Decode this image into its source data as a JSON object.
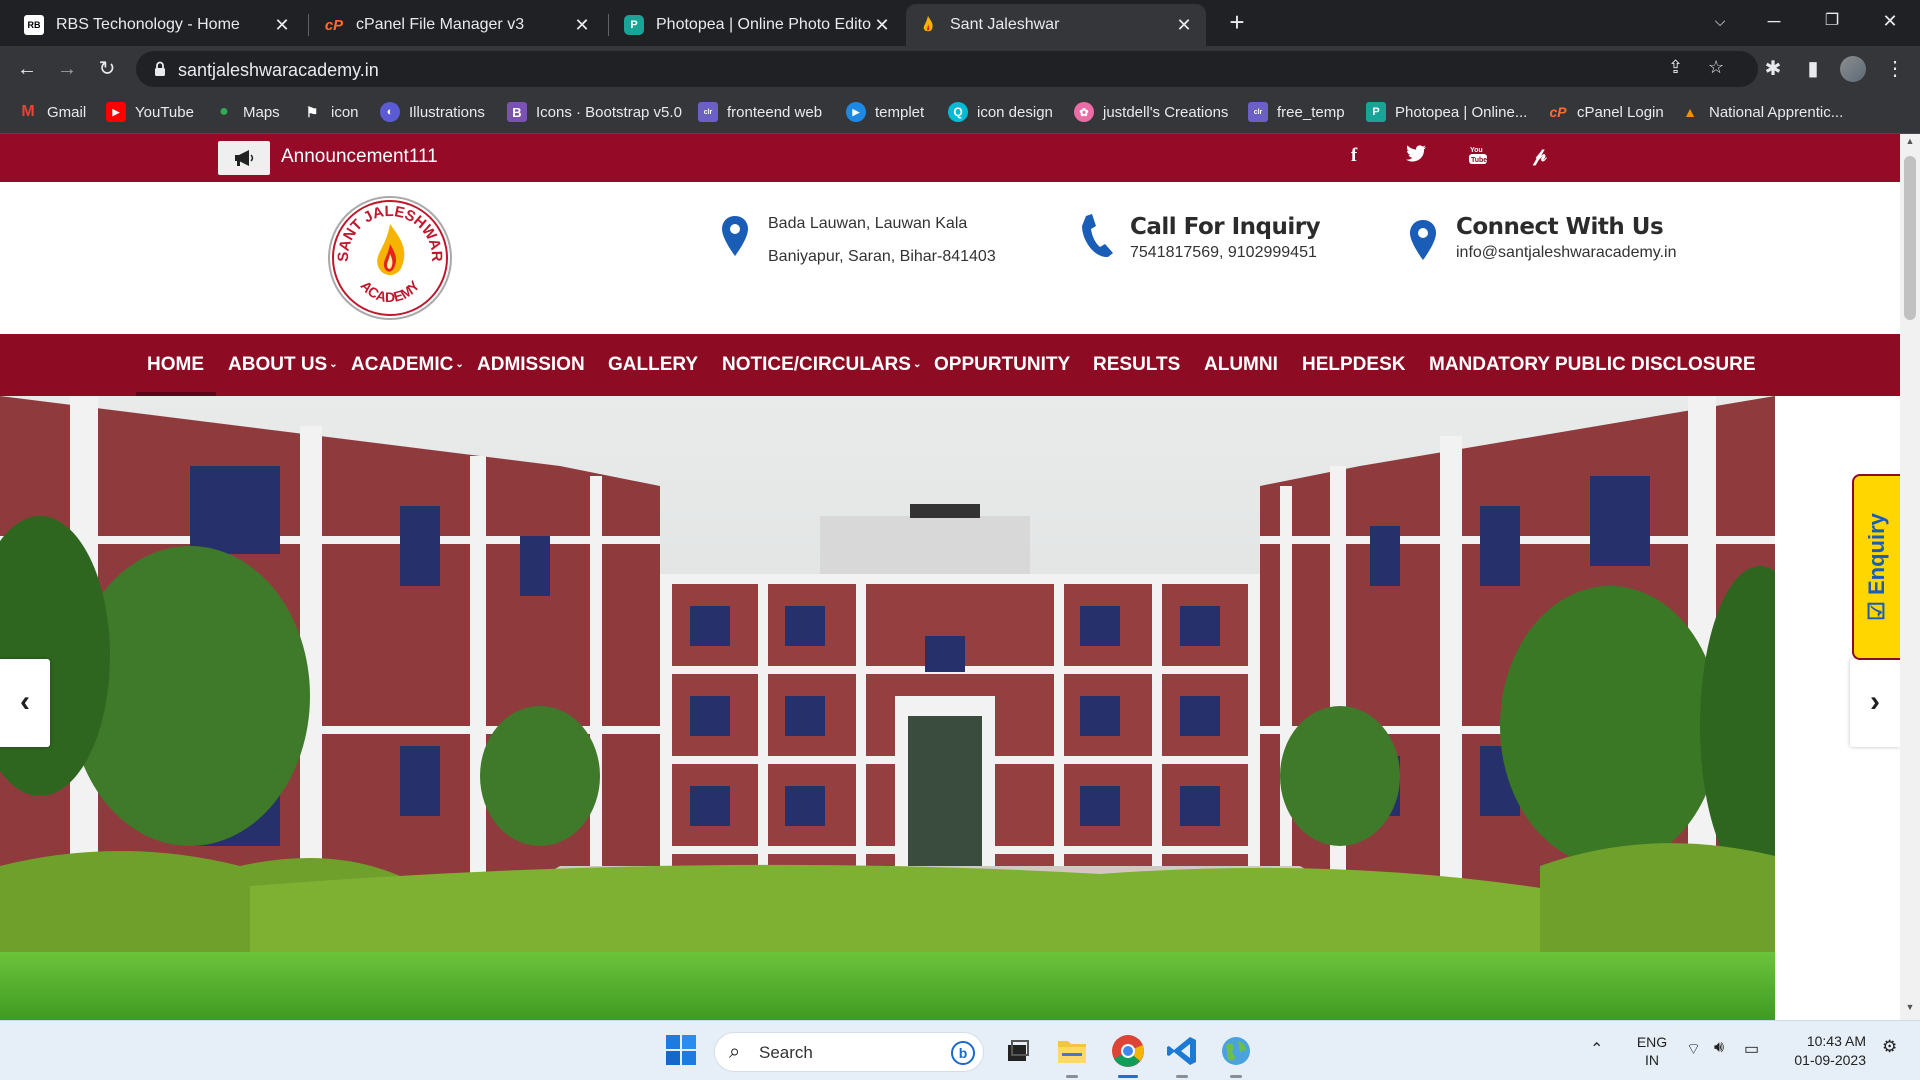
{
  "browser": {
    "tabs": [
      {
        "title": "RBS Techonology - Home",
        "favicon": "RB"
      },
      {
        "title": "cPanel File Manager v3",
        "favicon": "cP"
      },
      {
        "title": "Photopea | Online Photo Editor",
        "favicon": "P"
      },
      {
        "title": "Sant Jaleshwar",
        "favicon": "flame"
      }
    ],
    "url": "santjaleshwaracademy.in",
    "bookmarks": [
      {
        "label": "Gmail",
        "icon": "gmail-icon",
        "color": "#ea4335"
      },
      {
        "label": "YouTube",
        "icon": "youtube-icon",
        "color": "#ff0000"
      },
      {
        "label": "Maps",
        "icon": "maps-icon",
        "color": "#34a853"
      },
      {
        "label": "icon",
        "icon": "flag-icon",
        "color": "#ffffff"
      },
      {
        "label": "Illustrations",
        "icon": "illustrations-icon",
        "color": "#5b5bd6"
      },
      {
        "label": "Icons · Bootstrap v5.0",
        "icon": "bootstrap-icon",
        "color": "#7952b3"
      },
      {
        "label": "fronteend web",
        "icon": "colorlib-icon",
        "color": "#6c5fc7"
      },
      {
        "label": "templet",
        "icon": "play-icon",
        "color": "#1e88e5"
      },
      {
        "label": "icon design",
        "icon": "search-icon",
        "color": "#00bcd4"
      },
      {
        "label": "justdell's Creations",
        "icon": "octopus-icon",
        "color": "#ec6da5"
      },
      {
        "label": "free_temp",
        "icon": "colorlib-icon",
        "color": "#6c5fc7"
      },
      {
        "label": "Photopea | Online...",
        "icon": "photopea-icon",
        "color": "#18a497"
      },
      {
        "label": "cPanel Login",
        "icon": "cpanel-icon",
        "color": "#ff6c2c"
      },
      {
        "label": "National Apprentic...",
        "icon": "apprentice-icon",
        "color": "#f39200"
      }
    ]
  },
  "site": {
    "announcement": "Announcement111",
    "social": [
      "facebook-icon",
      "twitter-icon",
      "youtube-icon",
      "pinterest-icon"
    ],
    "logo": {
      "top_text": "SANT JALESHWAR",
      "bottom_text": "ACADEMY"
    },
    "address": {
      "line1": "Bada Lauwan, Lauwan Kala",
      "line2": "Baniyapur, Saran, Bihar-841403"
    },
    "call": {
      "title": "Call For Inquiry",
      "numbers": "7541817569, 9102999451"
    },
    "connect": {
      "title": "Connect With Us",
      "email": "info@santjaleshwaracademy.in"
    },
    "nav": [
      {
        "label": "HOME",
        "dropdown": false,
        "active": true
      },
      {
        "label": "ABOUT US",
        "dropdown": true
      },
      {
        "label": "ACADEMIC",
        "dropdown": true
      },
      {
        "label": "ADMISSION",
        "dropdown": false
      },
      {
        "label": "GALLERY",
        "dropdown": false
      },
      {
        "label": "NOTICE/CIRCULARS",
        "dropdown": true
      },
      {
        "label": "OPPURTUNITY",
        "dropdown": false
      },
      {
        "label": "RESULTS",
        "dropdown": false
      },
      {
        "label": "ALUMNI",
        "dropdown": false
      },
      {
        "label": "HELPDESK",
        "dropdown": false
      },
      {
        "label": "MANDATORY PUBLIC DISCLOSURE",
        "dropdown": false
      }
    ],
    "enquiry_label": "Enquiry",
    "colors": {
      "brand_red": "#950a27",
      "nav_red": "#8e0b24",
      "enquiry_yellow": "#ffd600",
      "pin_blue": "#1a5db6"
    }
  },
  "taskbar": {
    "search_placeholder": "Search",
    "language": {
      "line1": "ENG",
      "line2": "IN"
    },
    "time": "10:43 AM",
    "date": "01-09-2023"
  }
}
